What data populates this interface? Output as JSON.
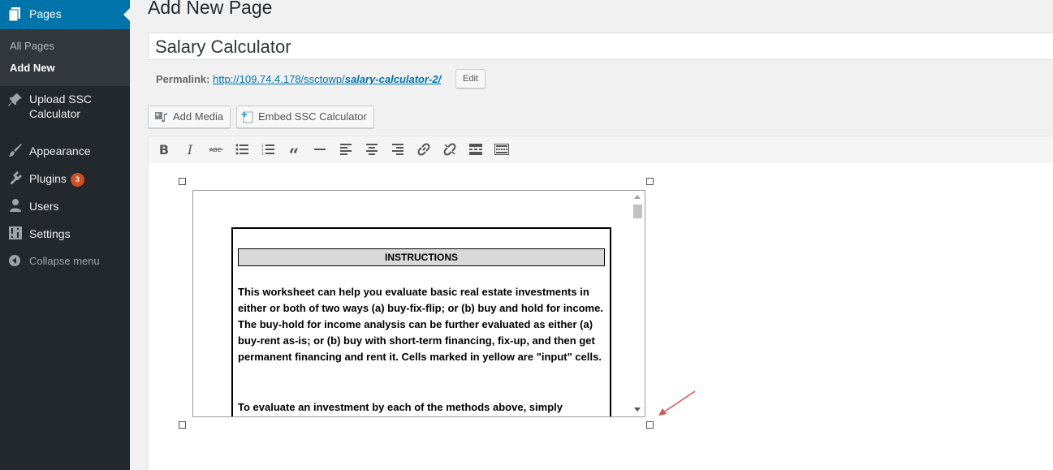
{
  "sidebar": {
    "current": "Pages",
    "submenu": [
      "All Pages",
      "Add New"
    ],
    "items": [
      {
        "label": "Upload SSC",
        "label2": "Calculator",
        "icon": "pin-icon"
      },
      {
        "label": "Appearance",
        "icon": "paintbrush-icon"
      },
      {
        "label": "Plugins",
        "icon": "plugin-icon",
        "badge": "3"
      },
      {
        "label": "Users",
        "icon": "user-icon"
      },
      {
        "label": "Settings",
        "icon": "settings-icon"
      }
    ],
    "collapse": "Collapse menu"
  },
  "page": {
    "heading": "Add New Page",
    "title_value": "Salary Calculator",
    "permalink_label": "Permalink:",
    "permalink_base": "http://109.74.4.178/ssctowp/",
    "permalink_slug": "salary-calculator-2/",
    "edit_label": "Edit",
    "add_media_label": "Add Media",
    "embed_label": "Embed SSC Calculator"
  },
  "content": {
    "instructions_heading": "INSTRUCTIONS",
    "paragraph1": "This worksheet can help you evaluate basic real estate investments in either or both of two ways (a) buy-fix-flip; or (b) buy and hold for income.  The buy-hold for income analysis can be further evaluated as either (a) buy-rent as-is; or (b) buy with short-term financing, fix-up, and then get permanent financing and rent it.  Cells marked in yellow are \"input\" cells.",
    "paragraph2": "To evaluate an investment by each of the methods above, simply"
  },
  "colors": {
    "sidebar_bg": "#23282d",
    "accent": "#0073aa",
    "badge": "#d54e21",
    "annotation_arrow": "#d9534f"
  }
}
